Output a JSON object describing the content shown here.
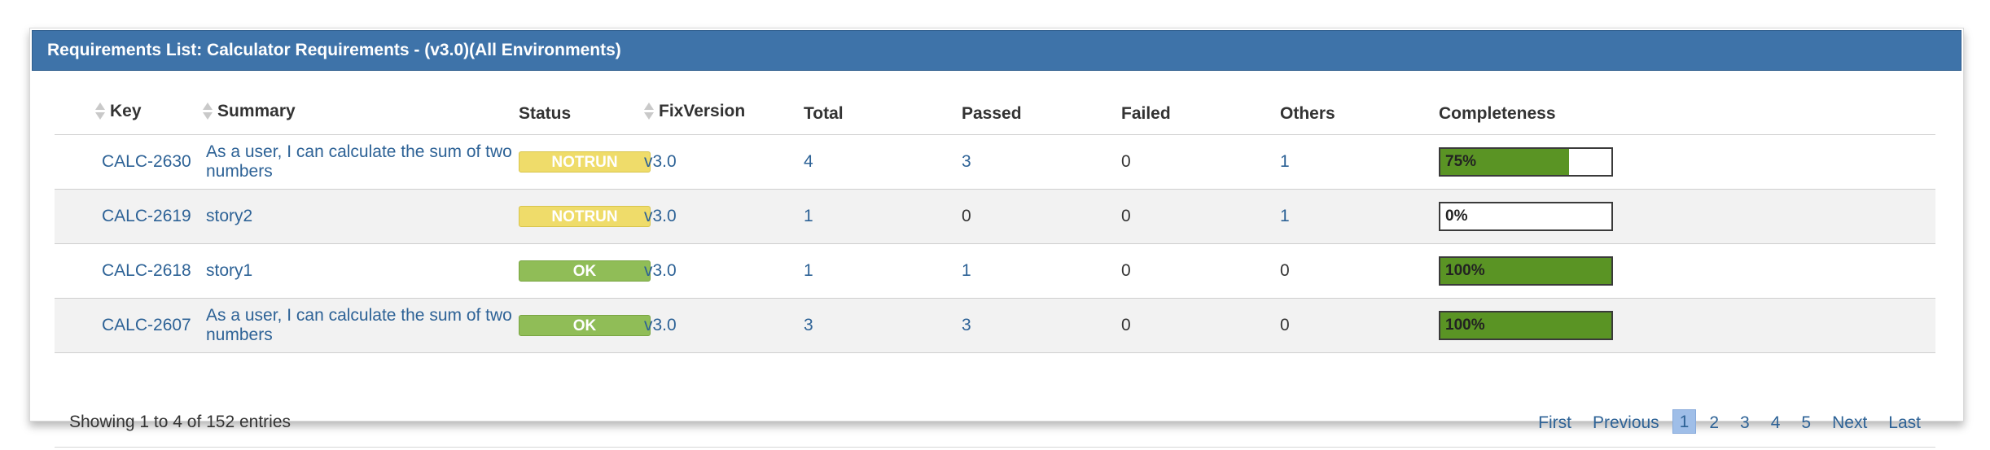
{
  "panel": {
    "title": "Requirements List: Calculator Requirements - (v3.0)(All Environments)"
  },
  "table": {
    "columns": {
      "key": "Key",
      "summary": "Summary",
      "status": "Status",
      "fix_version": "FixVersion",
      "total": "Total",
      "passed": "Passed",
      "failed": "Failed",
      "others": "Others",
      "completeness": "Completeness"
    },
    "rows": [
      {
        "key": "CALC-2630",
        "summary": "As a user, I can calculate the sum of two numbers",
        "status": "NOTRUN",
        "fix_version": "v3.0",
        "total": "4",
        "passed": "3",
        "failed": "0",
        "others": "1",
        "completeness": "75%",
        "completeness_fraction": 0.75
      },
      {
        "key": "CALC-2619",
        "summary": "story2",
        "status": "NOTRUN",
        "fix_version": "v3.0",
        "total": "1",
        "passed": "0",
        "failed": "0",
        "others": "1",
        "completeness": "0%",
        "completeness_fraction": 0.0
      },
      {
        "key": "CALC-2618",
        "summary": "story1",
        "status": "OK",
        "fix_version": "v3.0",
        "total": "1",
        "passed": "1",
        "failed": "0",
        "others": "0",
        "completeness": "100%",
        "completeness_fraction": 1.0
      },
      {
        "key": "CALC-2607",
        "summary": "As a user, I can calculate the sum of two numbers",
        "status": "OK",
        "fix_version": "v3.0",
        "total": "3",
        "passed": "3",
        "failed": "0",
        "others": "0",
        "completeness": "100%",
        "completeness_fraction": 1.0
      }
    ]
  },
  "footer": {
    "info": "Showing 1 to 4 of 152 entries",
    "pager": {
      "first": "First",
      "previous": "Previous",
      "pages": [
        "1",
        "2",
        "3",
        "4",
        "5"
      ],
      "current_page": "1",
      "next": "Next",
      "last": "Last"
    }
  },
  "colors": {
    "header_bg": "#3e73a9",
    "link": "#2d6296",
    "notrun": "#efdc6a",
    "ok": "#90bd57",
    "progress_fill": "#5a9424",
    "current_page_bg": "#9fbee8"
  },
  "icons": {
    "sort": "sort-both-icon"
  }
}
